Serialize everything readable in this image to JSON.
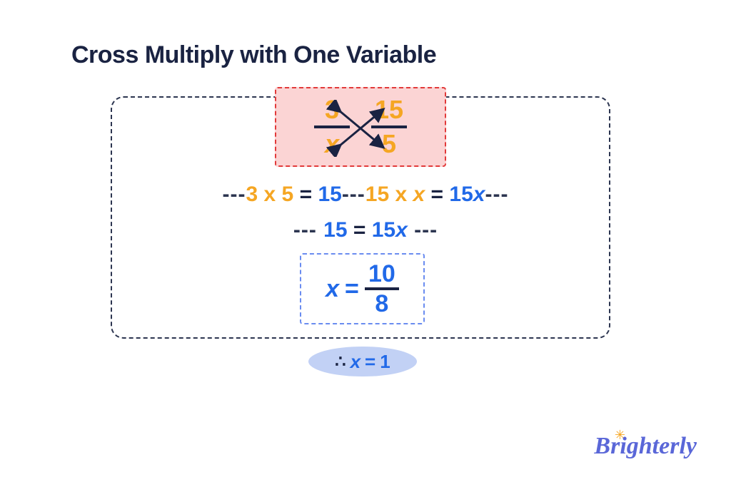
{
  "title": "Cross Multiply with One Variable",
  "colors": {
    "orange": "#f5a623",
    "blue": "#2169e8",
    "dark": "#1a2342",
    "red": "#e23a3a",
    "pink_bg": "#fbd4d4",
    "light_blue_border": "#6a8cf0",
    "oval_bg": "#c2d1f5"
  },
  "step1": {
    "left_fraction": {
      "numerator": "3",
      "denominator": "x"
    },
    "right_fraction": {
      "numerator": "15",
      "denominator": "5"
    }
  },
  "step2": {
    "dash_left": "---",
    "left_factor1": "3",
    "mult1": " x ",
    "left_factor2": "5",
    "eq1": " = ",
    "left_result": "15",
    "dash_mid": "---",
    "right_factor1": "15",
    "mult2": " x ",
    "right_factor2": "x",
    "eq2": " = ",
    "right_result_num": "15",
    "right_result_var": "x",
    "dash_right": "---"
  },
  "step3": {
    "dash_left": "--- ",
    "left": "15",
    "eq": " = ",
    "right_num": "15",
    "right_var": "x",
    "dash_right": " ---"
  },
  "step4": {
    "var": "x",
    "eq": "=",
    "numerator": "10",
    "denominator": "8"
  },
  "conclusion": {
    "therefore": "∴",
    "var": "x",
    "eq": "=",
    "value": "1"
  },
  "logo": {
    "text": "Brighterly",
    "sun": "✳"
  }
}
